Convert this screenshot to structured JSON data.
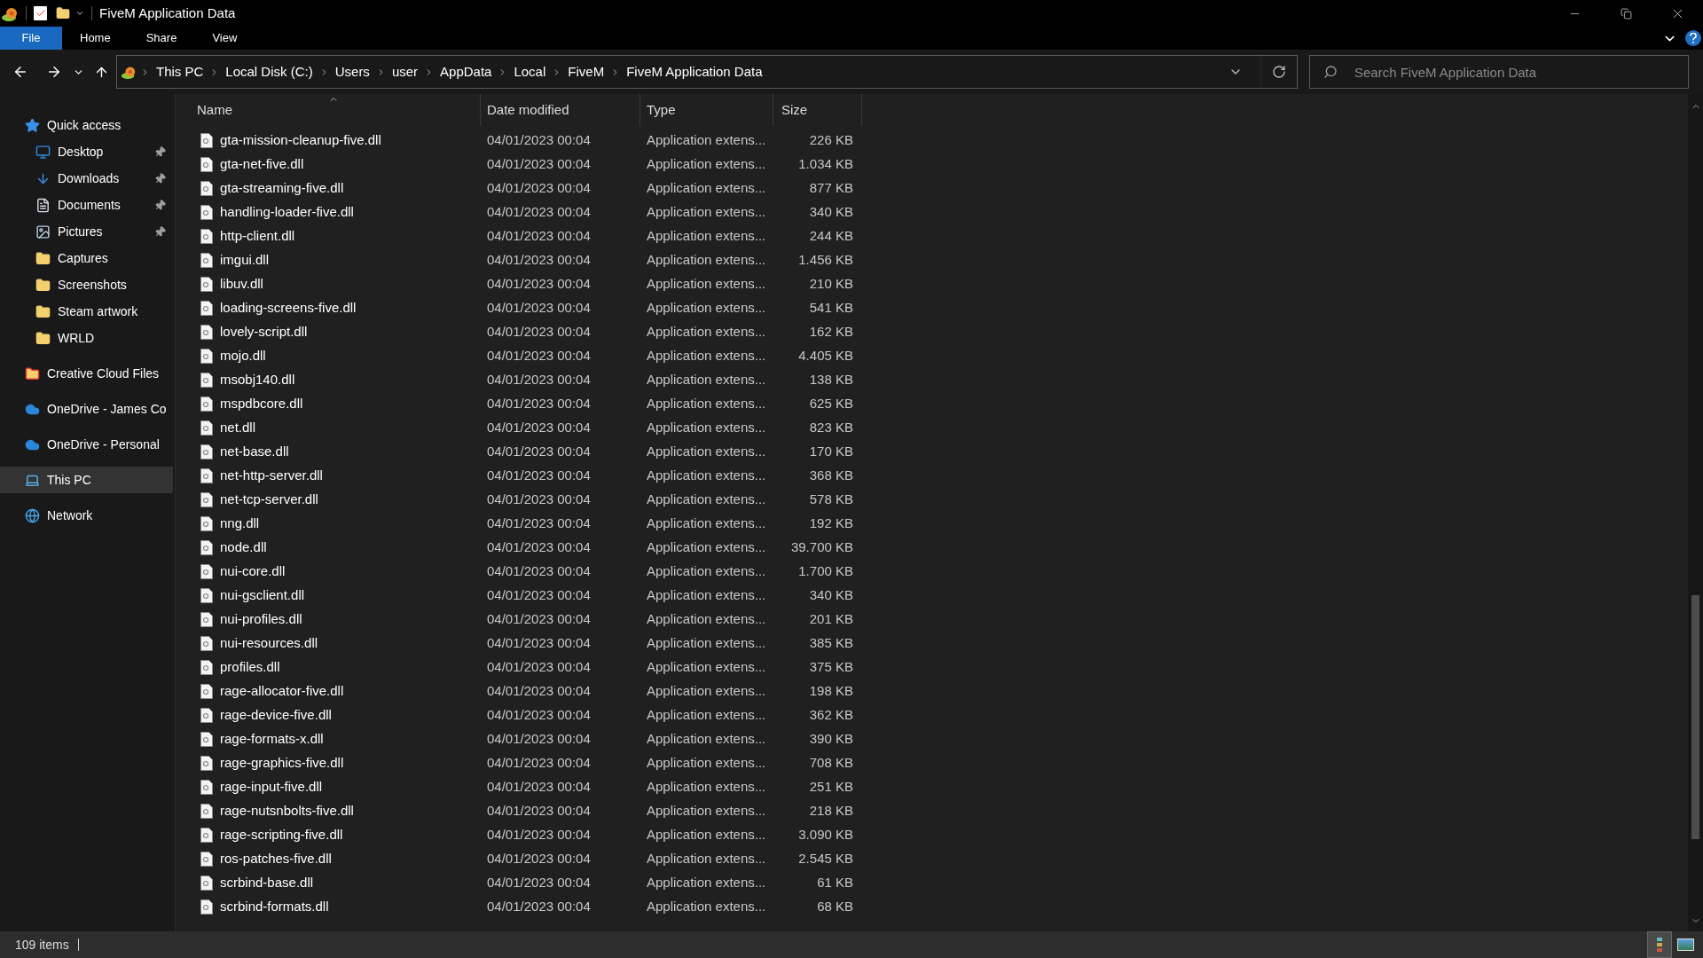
{
  "window": {
    "title": "FiveM Application Data"
  },
  "ribbon_tabs": [
    {
      "label": "File",
      "selected": true
    },
    {
      "label": "Home",
      "selected": false
    },
    {
      "label": "Share",
      "selected": false
    },
    {
      "label": "View",
      "selected": false
    }
  ],
  "breadcrumb": [
    "This PC",
    "Local Disk (C:)",
    "Users",
    "user",
    "AppData",
    "Local",
    "FiveM",
    "FiveM Application Data"
  ],
  "search": {
    "placeholder": "Search FiveM Application Data"
  },
  "sidebar": {
    "items": [
      {
        "label": "Quick access",
        "kind": "star",
        "selected": false,
        "children": [
          {
            "label": "Desktop",
            "kind": "desktop",
            "pinned": true,
            "selected": false
          },
          {
            "label": "Downloads",
            "kind": "download",
            "pinned": true,
            "selected": false
          },
          {
            "label": "Documents",
            "kind": "document",
            "pinned": true,
            "selected": false
          },
          {
            "label": "Pictures",
            "kind": "picture",
            "pinned": true,
            "selected": false
          },
          {
            "label": "Captures",
            "kind": "folder",
            "pinned": false,
            "selected": false
          },
          {
            "label": "Screenshots",
            "kind": "folder",
            "pinned": false,
            "selected": false
          },
          {
            "label": "Steam artwork",
            "kind": "folder",
            "pinned": false,
            "selected": false
          },
          {
            "label": "WRLD",
            "kind": "folder",
            "pinned": false,
            "selected": false
          }
        ]
      },
      {
        "label": "Creative Cloud Files",
        "kind": "cc",
        "selected": false
      },
      {
        "label": "OneDrive - James Co",
        "kind": "cloud",
        "selected": false
      },
      {
        "label": "OneDrive - Personal",
        "kind": "cloud",
        "selected": false
      },
      {
        "label": "This PC",
        "kind": "pc",
        "selected": true
      },
      {
        "label": "Network",
        "kind": "network",
        "selected": false
      }
    ]
  },
  "table": {
    "columns": [
      "Name",
      "Date modified",
      "Type",
      "Size"
    ],
    "rows": [
      {
        "name": "gta-mission-cleanup-five.dll",
        "date": "04/01/2023 00:04",
        "type": "Application extens...",
        "size": "226 KB"
      },
      {
        "name": "gta-net-five.dll",
        "date": "04/01/2023 00:04",
        "type": "Application extens...",
        "size": "1.034 KB"
      },
      {
        "name": "gta-streaming-five.dll",
        "date": "04/01/2023 00:04",
        "type": "Application extens...",
        "size": "877 KB"
      },
      {
        "name": "handling-loader-five.dll",
        "date": "04/01/2023 00:04",
        "type": "Application extens...",
        "size": "340 KB"
      },
      {
        "name": "http-client.dll",
        "date": "04/01/2023 00:04",
        "type": "Application extens...",
        "size": "244 KB"
      },
      {
        "name": "imgui.dll",
        "date": "04/01/2023 00:04",
        "type": "Application extens...",
        "size": "1.456 KB"
      },
      {
        "name": "libuv.dll",
        "date": "04/01/2023 00:04",
        "type": "Application extens...",
        "size": "210 KB"
      },
      {
        "name": "loading-screens-five.dll",
        "date": "04/01/2023 00:04",
        "type": "Application extens...",
        "size": "541 KB"
      },
      {
        "name": "lovely-script.dll",
        "date": "04/01/2023 00:04",
        "type": "Application extens...",
        "size": "162 KB"
      },
      {
        "name": "mojo.dll",
        "date": "04/01/2023 00:04",
        "type": "Application extens...",
        "size": "4.405 KB"
      },
      {
        "name": "msobj140.dll",
        "date": "04/01/2023 00:04",
        "type": "Application extens...",
        "size": "138 KB"
      },
      {
        "name": "mspdbcore.dll",
        "date": "04/01/2023 00:04",
        "type": "Application extens...",
        "size": "625 KB"
      },
      {
        "name": "net.dll",
        "date": "04/01/2023 00:04",
        "type": "Application extens...",
        "size": "823 KB"
      },
      {
        "name": "net-base.dll",
        "date": "04/01/2023 00:04",
        "type": "Application extens...",
        "size": "170 KB"
      },
      {
        "name": "net-http-server.dll",
        "date": "04/01/2023 00:04",
        "type": "Application extens...",
        "size": "368 KB"
      },
      {
        "name": "net-tcp-server.dll",
        "date": "04/01/2023 00:04",
        "type": "Application extens...",
        "size": "578 KB"
      },
      {
        "name": "nng.dll",
        "date": "04/01/2023 00:04",
        "type": "Application extens...",
        "size": "192 KB"
      },
      {
        "name": "node.dll",
        "date": "04/01/2023 00:04",
        "type": "Application extens...",
        "size": "39.700 KB"
      },
      {
        "name": "nui-core.dll",
        "date": "04/01/2023 00:04",
        "type": "Application extens...",
        "size": "1.700 KB"
      },
      {
        "name": "nui-gsclient.dll",
        "date": "04/01/2023 00:04",
        "type": "Application extens...",
        "size": "340 KB"
      },
      {
        "name": "nui-profiles.dll",
        "date": "04/01/2023 00:04",
        "type": "Application extens...",
        "size": "201 KB"
      },
      {
        "name": "nui-resources.dll",
        "date": "04/01/2023 00:04",
        "type": "Application extens...",
        "size": "385 KB"
      },
      {
        "name": "profiles.dll",
        "date": "04/01/2023 00:04",
        "type": "Application extens...",
        "size": "375 KB"
      },
      {
        "name": "rage-allocator-five.dll",
        "date": "04/01/2023 00:04",
        "type": "Application extens...",
        "size": "198 KB"
      },
      {
        "name": "rage-device-five.dll",
        "date": "04/01/2023 00:04",
        "type": "Application extens...",
        "size": "362 KB"
      },
      {
        "name": "rage-formats-x.dll",
        "date": "04/01/2023 00:04",
        "type": "Application extens...",
        "size": "390 KB"
      },
      {
        "name": "rage-graphics-five.dll",
        "date": "04/01/2023 00:04",
        "type": "Application extens...",
        "size": "708 KB"
      },
      {
        "name": "rage-input-five.dll",
        "date": "04/01/2023 00:04",
        "type": "Application extens...",
        "size": "251 KB"
      },
      {
        "name": "rage-nutsnbolts-five.dll",
        "date": "04/01/2023 00:04",
        "type": "Application extens...",
        "size": "218 KB"
      },
      {
        "name": "rage-scripting-five.dll",
        "date": "04/01/2023 00:04",
        "type": "Application extens...",
        "size": "3.090 KB"
      },
      {
        "name": "ros-patches-five.dll",
        "date": "04/01/2023 00:04",
        "type": "Application extens...",
        "size": "2.545 KB"
      },
      {
        "name": "scrbind-base.dll",
        "date": "04/01/2023 00:04",
        "type": "Application extens...",
        "size": "61 KB"
      },
      {
        "name": "scrbind-formats.dll",
        "date": "04/01/2023 00:04",
        "type": "Application extens...",
        "size": "68 KB"
      }
    ]
  },
  "status_bar": {
    "item_count": "109 items"
  }
}
